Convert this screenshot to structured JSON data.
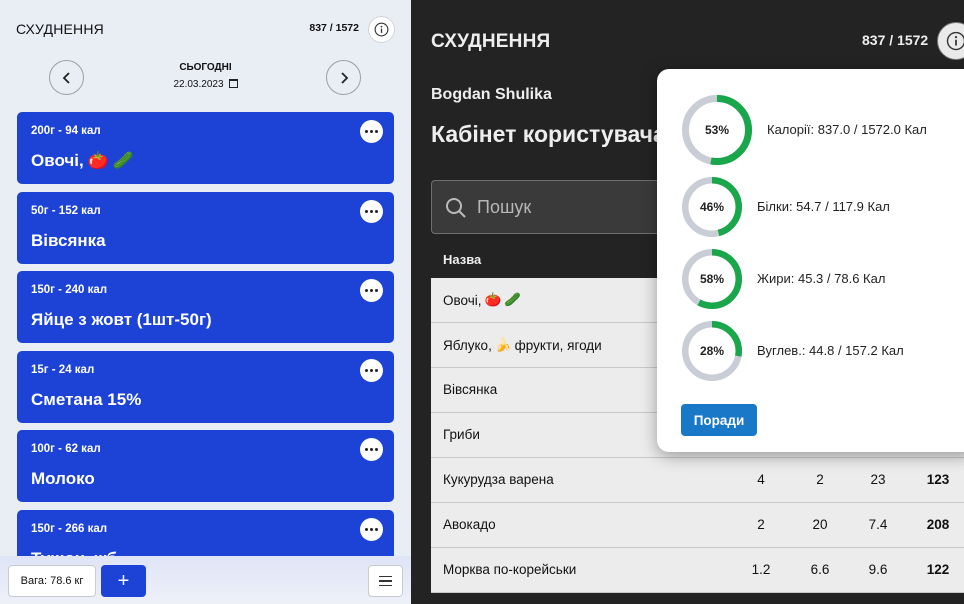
{
  "mobile": {
    "title": "СХУДНЕННЯ",
    "calories_count": "837 / 1572",
    "date_label": "СЬОГОДНІ",
    "date_value": "22.03.2023",
    "foods": [
      {
        "meta": "200г - 94 кал",
        "name": "Овочі,",
        "emoji": [
          "🍅",
          "🥒"
        ]
      },
      {
        "meta": "50г - 152 кал",
        "name": "Вівсянка",
        "emoji": []
      },
      {
        "meta": "150г - 240 кал",
        "name": "Яйце з жовт (1шт-50г)",
        "emoji": []
      },
      {
        "meta": "15г - 24 кал",
        "name": "Сметана 15%",
        "emoji": []
      },
      {
        "meta": "100г - 62 кал",
        "name": "Молоко",
        "emoji": []
      },
      {
        "meta": "150г - 266 кал",
        "name": "Тушон. жб",
        "emoji": []
      }
    ],
    "weight_label": "Вага: 78.6 кг",
    "add_label": "+",
    "accent_color": "#1d43d6"
  },
  "desktop": {
    "title": "СХУДНЕННЯ",
    "calories_count": "837 / 1572",
    "user_name": "Bogdan Shulika",
    "heading": "Кабінет користувача",
    "search_placeholder": "Пошук",
    "column_name": "Назва",
    "rows": [
      {
        "name": "Овочі,",
        "emoji": [
          "🍅",
          "🥒"
        ],
        "v1": "",
        "v2": "",
        "v3": "",
        "v4": ""
      },
      {
        "name": "Яблуко,",
        "emoji": [
          "🍌"
        ],
        "suffix": "фрукти, ягоди",
        "v1": "",
        "v2": "",
        "v3": "",
        "v4": ""
      },
      {
        "name": "Вівсянка",
        "emoji": [],
        "v1": "",
        "v2": "",
        "v3": "",
        "v4": ""
      },
      {
        "name": "Гриби",
        "emoji": [],
        "v1": "",
        "v2": "",
        "v3": "",
        "v4": ""
      },
      {
        "name": "Кукурудза варена",
        "emoji": [],
        "v1": "4",
        "v2": "2",
        "v3": "23",
        "v4": "123"
      },
      {
        "name": "Авокадо",
        "emoji": [],
        "v1": "2",
        "v2": "20",
        "v3": "7.4",
        "v4": "208"
      },
      {
        "name": "Морква по-корейськи",
        "emoji": [],
        "v1": "1.2",
        "v2": "6.6",
        "v3": "9.6",
        "v4": "122"
      }
    ],
    "stats": [
      {
        "percent": 53,
        "percent_label": "53%",
        "label": "Калорії: 837.0 / 1572.0 Кал"
      },
      {
        "percent": 46,
        "percent_label": "46%",
        "label": "Білки: 54.7 / 117.9 Кал"
      },
      {
        "percent": 58,
        "percent_label": "58%",
        "label": "Жири: 45.3 / 78.6 Кал"
      },
      {
        "percent": 28,
        "percent_label": "28%",
        "label": "Вуглев.: 44.8 / 157.2 Кал"
      }
    ],
    "tips_label": "Поради",
    "ring_color": "#1aa64a",
    "ring_track_color": "#c9ced6",
    "tips_color": "#1978c8"
  }
}
